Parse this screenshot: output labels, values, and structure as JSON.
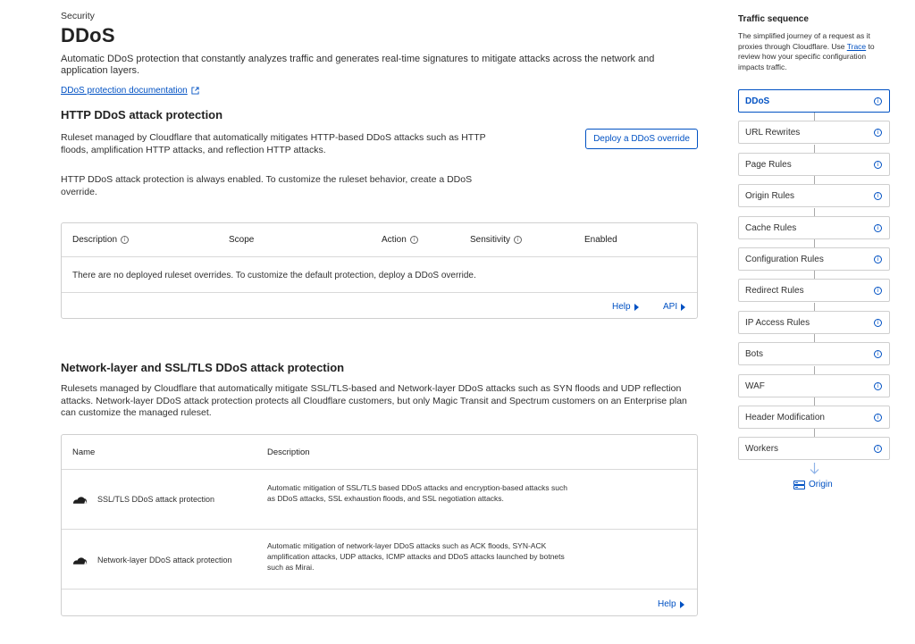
{
  "header": {
    "eyebrow": "Security",
    "title": "DDoS",
    "description": "Automatic DDoS protection that constantly analyzes traffic and generates real-time signatures to mitigate attacks across the network and application layers.",
    "doc_link": "DDoS protection documentation"
  },
  "http_section": {
    "title": "HTTP DDoS attack protection",
    "description": "Ruleset managed by Cloudflare that automatically mitigates HTTP-based DDoS attacks such as HTTP floods, amplification HTTP attacks, and reflection HTTP attacks.",
    "note": "HTTP DDoS attack protection is always enabled. To customize the ruleset behavior, create a DDoS override.",
    "deploy_button": "Deploy a DDoS override",
    "table": {
      "columns": [
        "Description",
        "Scope",
        "Action",
        "Sensitivity",
        "Enabled"
      ],
      "empty_message": "There are no deployed ruleset overrides. To customize the default protection, deploy a DDoS override.",
      "footer": {
        "help": "Help",
        "api": "API"
      }
    }
  },
  "network_section": {
    "title": "Network-layer and SSL/TLS DDoS attack protection",
    "description": "Rulesets managed by Cloudflare that automatically mitigate SSL/TLS-based and Network-layer DDoS attacks such as SYN floods and UDP reflection attacks. Network-layer DDoS attack protection protects all Cloudflare customers, but only Magic Transit and Spectrum customers on an Enterprise plan can customize the managed ruleset.",
    "table": {
      "columns": [
        "Name",
        "Description"
      ],
      "rows": [
        {
          "name": "SSL/TLS DDoS attack protection",
          "description": "Automatic mitigation of SSL/TLS based DDoS attacks and encryption-based attacks such as DDoS attacks, SSL exhaustion floods, and SSL negotiation attacks."
        },
        {
          "name": "Network-layer DDoS attack protection",
          "description": "Automatic mitigation of network-layer DDoS attacks such as ACK floods, SYN-ACK amplification attacks, UDP attacks, ICMP attacks and DDoS attacks launched by botnets such as Mirai."
        }
      ],
      "footer": {
        "help": "Help"
      }
    }
  },
  "sidebar": {
    "title": "Traffic sequence",
    "description_before": "The simplified journey of a request as it proxies through Cloudflare. Use ",
    "trace_link": "Trace",
    "description_after": " to review how your specific configuration impacts traffic.",
    "steps": [
      {
        "label": "DDoS",
        "active": true
      },
      {
        "label": "URL Rewrites"
      },
      {
        "label": "Page Rules"
      },
      {
        "label": "Origin Rules"
      },
      {
        "label": "Cache Rules"
      },
      {
        "label": "Configuration Rules"
      },
      {
        "label": "Redirect Rules"
      },
      {
        "label": "IP Access Rules"
      },
      {
        "label": "Bots"
      },
      {
        "label": "WAF"
      },
      {
        "label": "Header Modification"
      },
      {
        "label": "Workers"
      }
    ],
    "origin": "Origin"
  },
  "colors": {
    "accent": "#0051c3",
    "border": "#cfcfcf",
    "text": "#313131"
  }
}
